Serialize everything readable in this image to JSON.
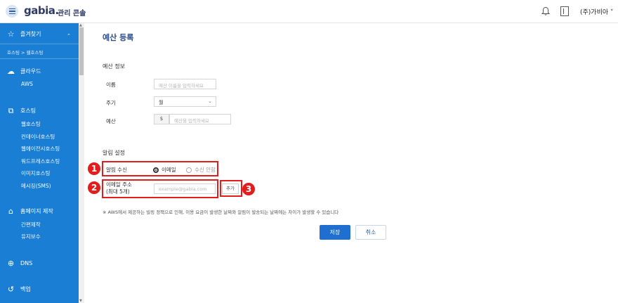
{
  "header": {
    "logo": "gabia.",
    "logo_sub": "관리 콘솔",
    "user": "(주)가비아 ˅"
  },
  "sidebar": {
    "favorites": "즐겨찾기",
    "breadcrumb": "호스팅 > 웹호스팅",
    "cloud": "클라우드",
    "cloud_items": [
      "AWS"
    ],
    "hosting": "호스팅",
    "hosting_items": [
      "웹호스팅",
      "컨테이너호스팅",
      "웹에이전시호스팅",
      "워드프레스호스팅",
      "이미지호스팅",
      "메시징(SMS)"
    ],
    "homepage": "홈페이지 제작",
    "homepage_items": [
      "간편제작",
      "유지보수"
    ],
    "dns": "DNS",
    "backup": "백업"
  },
  "page": {
    "title": "예산 등록",
    "section_budget": "예산 정보",
    "name_label": "이름",
    "name_placeholder": "예산 이름을 입력하세요",
    "period_label": "주기",
    "period_value": "월",
    "budget_label": "예산",
    "currency": "$",
    "budget_placeholder": "예산을 입력하세요",
    "section_alert": "알림 설정",
    "alert_receive_label": "알림 수신",
    "radio_email": "이메일",
    "radio_none": "수신 안함",
    "email_label_1": "이메일 주소",
    "email_label_2": "(최대 5개)",
    "email_placeholder": "example@gabia.com",
    "add_button": "추가",
    "notice": "※ AWS에서 제공하는 빌링 정책으로 인해, 이용 요금이 발생한 날짜와 알림이 발송되는 날짜에는 차이가 발생할 수 있습니다",
    "save_button": "저장",
    "cancel_button": "취소"
  },
  "badges": [
    "1",
    "2",
    "3"
  ],
  "colors": {
    "sidebar": "#1a7fd4",
    "accent": "#1f6fd0",
    "highlight": "#e31c1c"
  }
}
